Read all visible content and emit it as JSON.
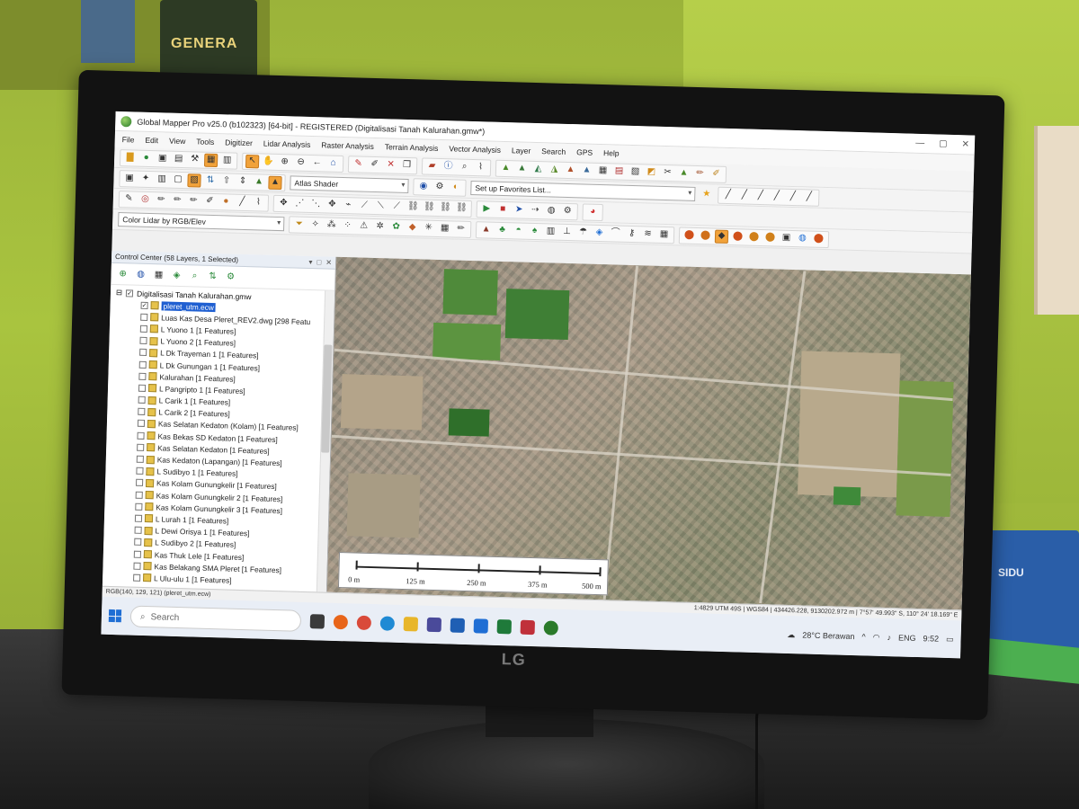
{
  "window": {
    "title": "Global Mapper Pro v25.0 (b102323) [64-bit] - REGISTERED (Digitalisasi Tanah Kalurahan.gmw*)"
  },
  "menu": [
    "File",
    "Edit",
    "View",
    "Tools",
    "Digitizer",
    "Lidar Analysis",
    "Raster Analysis",
    "Terrain Analysis",
    "Vector Analysis",
    "Layer",
    "Search",
    "GPS",
    "Help"
  ],
  "toolbar": {
    "shader_select": "Atlas Shader",
    "favorites_select": "Set up Favorites List...",
    "lidar_color_select": "Color Lidar by RGB/Elev"
  },
  "control_center": {
    "title": "Control Center (58 Layers, 1 Selected)",
    "root": "Digitalisasi Tanah Kalurahan.gmw",
    "layers": [
      "pleret_utm.ecw",
      "Luas Kas Desa Pleret_REV2.dwg [298 Featu",
      "L Yuono 1 [1 Features]",
      "L Yuono 2 [1 Features]",
      "L Dk Trayeman 1 [1 Features]",
      "L Dk Gunungan 1 [1 Features]",
      "Kalurahan [1 Features]",
      "L Pangripto 1 [1 Features]",
      "L Carik 1 [1 Features]",
      "L Carik 2 [1 Features]",
      "Kas Selatan Kedaton (Kolam) [1 Features]",
      "Kas Bekas SD Kedaton [1 Features]",
      "Kas Selatan Kedaton [1 Features]",
      "Kas Kedaton (Lapangan) [1 Features]",
      "L Sudibyo 1 [1 Features]",
      "Kas Kolam Gunungkelir [1 Features]",
      "Kas Kolam Gunungkelir 2 [1 Features]",
      "Kas Kolam Gunungkelir 3 [1 Features]",
      "L Lurah 1 [1 Features]",
      "L Dewi Orisya 1 [1 Features]",
      "L Sudibyo 2 [1 Features]",
      "Kas Thuk Lele [1 Features]",
      "Kas Belakang SMA Pleret [1 Features]",
      "L Ulu-ulu 1 [1 Features]"
    ]
  },
  "scalebar": {
    "labels": [
      "0 m",
      "125 m",
      "250 m",
      "375 m",
      "500 m"
    ]
  },
  "status": {
    "left": "RGB(140, 129, 121) (pleret_utm.ecw)",
    "right": "1:4829  UTM 49S | WGS84 | 434426.228, 9130202.972 m | 7°57' 49.993\" S, 110° 24' 18.169\" E"
  },
  "taskbar": {
    "search_placeholder": "Search",
    "weather": "28°C  Berawan",
    "language": "ENG",
    "time": "9:52"
  },
  "scene": {
    "monitor_brand": "LG",
    "shelf_label": "GENERA",
    "box_label": "SIDU"
  }
}
